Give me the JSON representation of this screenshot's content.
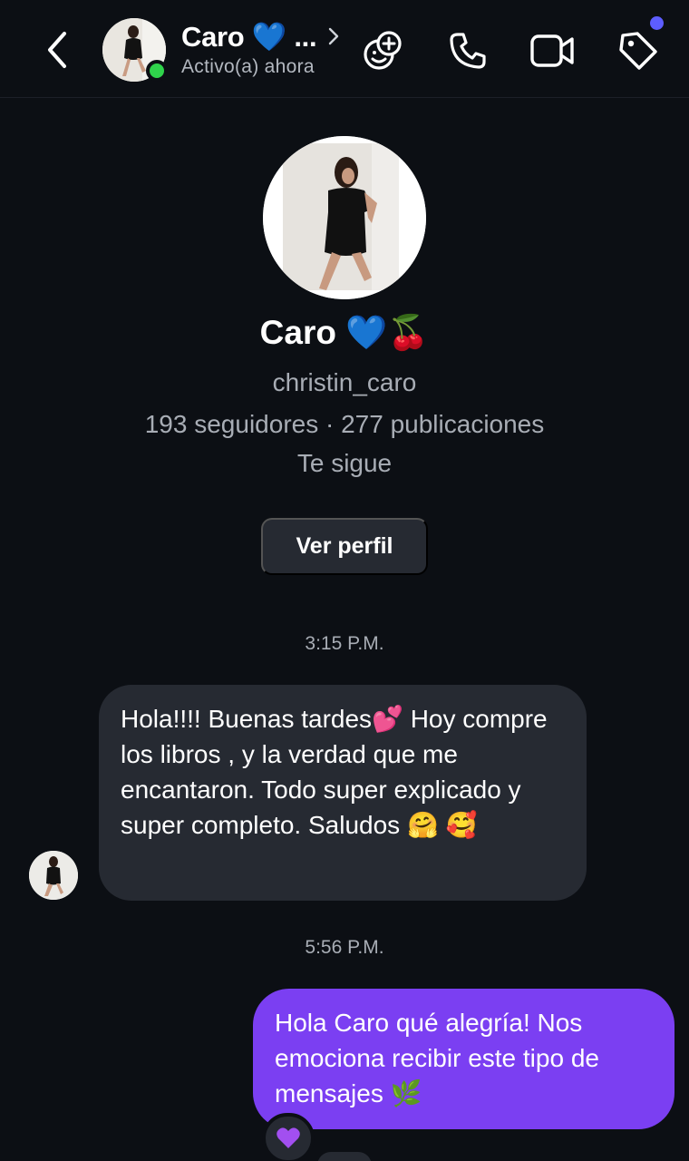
{
  "header": {
    "contact_name": "Caro 💙 ...",
    "status": "Activo(a) ahora"
  },
  "profile": {
    "name": "Caro 💙🍒",
    "username": "christin_caro",
    "stats": "193 seguidores · 277 publicaciones",
    "follows_you": "Te sigue",
    "view_profile_label": "Ver perfil"
  },
  "messages": [
    {
      "timestamp": "3:15 P.M.",
      "direction": "incoming",
      "text": "Hola!!!! Buenas tardes💕 Hoy compre los libros , y la verdad que me encantaron. Todo super explicado y super completo. Saludos 🤗 🥰"
    },
    {
      "timestamp": "5:56 P.M.",
      "direction": "outgoing",
      "text": "Hola Caro qué alegría! Nos emociona recibir este tipo de mensajes 🌿",
      "reaction": "💜"
    }
  ],
  "colors": {
    "background": "#0c0f14",
    "incoming_bubble": "#262a32",
    "outgoing_bubble": "#7b3ff2",
    "online": "#2fd34b",
    "notification": "#5d5dff"
  },
  "icons": [
    "back-arrow-icon",
    "chevron-right-icon",
    "add-people-icon",
    "phone-icon",
    "video-camera-icon",
    "tag-icon",
    "purple-heart-icon"
  ]
}
